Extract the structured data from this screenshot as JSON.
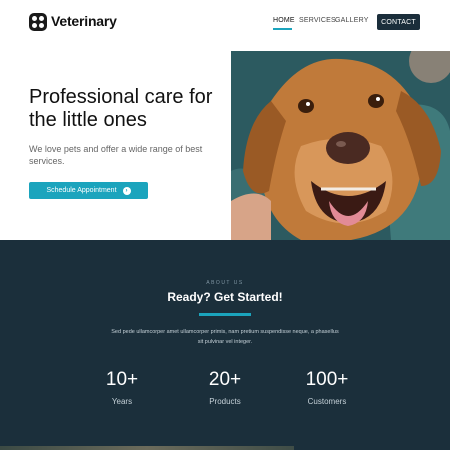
{
  "header": {
    "brand": "Veterinary",
    "nav": {
      "home": "HOME",
      "services": "SERVICES",
      "gallery": "GALLERY",
      "contact": "CONTACT"
    },
    "active_tab": "HOME"
  },
  "hero": {
    "title": "Professional care for the little ones",
    "subtitle": "We love pets and offer a wide range of best services.",
    "cta_label": "Schedule Appointment",
    "image_icon": "dog-photo"
  },
  "about": {
    "eyebrow": "ABOUT US",
    "title": "Ready? Get Started!",
    "text": "Sed pede ullamcorper amet ullamcorper primis, nam pretium suspendisse neque, a phasellus sit pulvinar vel integer.",
    "stats": [
      {
        "number": "10+",
        "label": "Years"
      },
      {
        "number": "20+",
        "label": "Products"
      },
      {
        "number": "100+",
        "label": "Customers"
      }
    ]
  },
  "colors": {
    "accent": "#1ba4bd",
    "dark": "#1b2f3b",
    "text": "#111111"
  }
}
